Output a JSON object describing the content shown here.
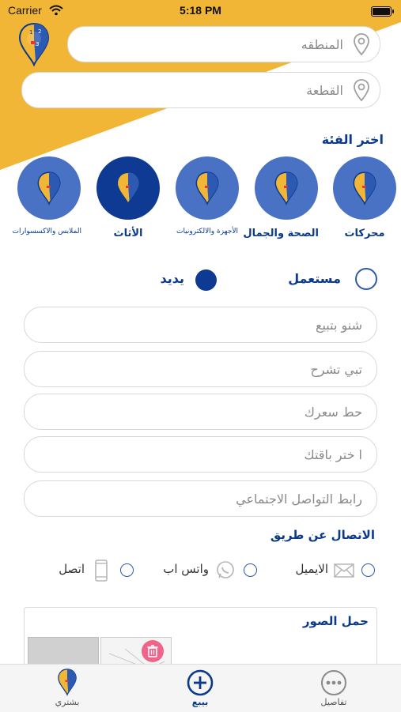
{
  "status_bar": {
    "carrier": "Carrier",
    "time": "5:18 PM"
  },
  "location": {
    "region_placeholder": "المنطقه",
    "block_placeholder": "القطعة"
  },
  "category": {
    "title": "اختر الفئة",
    "items": [
      {
        "label": "محركات",
        "selected": false
      },
      {
        "label": "الصحة والجمال",
        "selected": false
      },
      {
        "label": "الأجهزة والالكترونيات",
        "selected": false
      },
      {
        "label": "الأثاث",
        "selected": true
      },
      {
        "label": "الملابس والاكسسوارات",
        "selected": false
      }
    ]
  },
  "condition": {
    "used_label": "مستعمل",
    "new_label": "يديد",
    "selected": "new"
  },
  "form": {
    "what_selling_placeholder": "شنو بتبيع",
    "describe_placeholder": "تبي تشرح",
    "price_placeholder": "حط سعرك",
    "package_placeholder": "ا ختر باقتك",
    "social_link_placeholder": "رابط التواصل الاجتماعي"
  },
  "contact": {
    "title": "الاتصال عن طريق",
    "options": [
      {
        "label": "الايميل",
        "icon": "envelope-icon"
      },
      {
        "label": "واتس اب",
        "icon": "whatsapp-icon"
      },
      {
        "label": "اتصل",
        "icon": "phone-icon"
      }
    ]
  },
  "upload": {
    "title": "حمل الصور"
  },
  "tabbar": {
    "tabs": [
      {
        "label": "بشتري",
        "icon": "logo-icon"
      },
      {
        "label": "بيبع",
        "icon": "plus-circle-icon",
        "active": true
      },
      {
        "label": "تفاصيل",
        "icon": "more-icon"
      }
    ]
  },
  "colors": {
    "yellow": "#f2b636",
    "navy": "#0b3a8c",
    "blue": "#4a72c4",
    "dark_blue": "#0e3a93"
  }
}
